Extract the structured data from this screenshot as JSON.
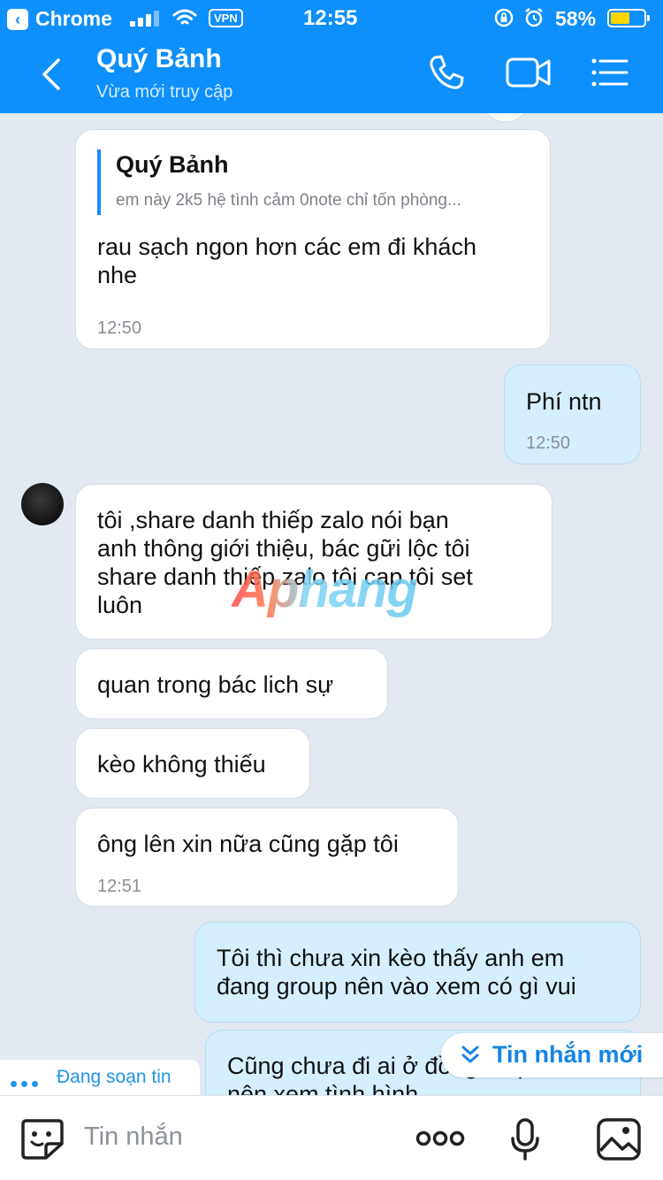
{
  "status_bar": {
    "back_app": "Chrome",
    "vpn": "VPN",
    "time": "12:55",
    "battery": "58%",
    "battery_level": 0.58
  },
  "header": {
    "name": "Quý Bảnh",
    "subtitle": "Vừa mới truy cập"
  },
  "messages": {
    "m1": {
      "quote_name": "Quý Bảnh",
      "quote_text": "em này 2k5 hệ tình cảm 0note chỉ tốn phòng...",
      "text1": "rau sạch ngon hơn các em đi khách",
      "text2": "nhe",
      "time": "12:50"
    },
    "m2": {
      "text": "Phí ntn",
      "time": "12:50"
    },
    "m3": {
      "l1": "tôi ,share danh thiếp zalo nói bạn",
      "l2": "anh thông giới thiệu,  bác gữi lộc tôi",
      "l3": "share danh thiếp zalo tôi cap tôi set",
      "l4": "luôn"
    },
    "m4": {
      "text": "quan trong bác lich sự"
    },
    "m5": {
      "text": "kèo không thiếu"
    },
    "m6": {
      "text": "ông lên xin nữa cũng gặp tôi",
      "time": "12:51"
    },
    "m7": {
      "l1": "Tôi thì chưa xin kèo thấy anh em",
      "l2": "đang group nên vào xem có gì vui"
    },
    "m8": {
      "l1": "Cũng chưa đi ai ở đồng tháp hết",
      "l2": "nên xem tình hình"
    }
  },
  "watermark": "Aphang",
  "typing_label": "Đang soạn tin",
  "new_message_label": "Tin nhắn mới",
  "composer": {
    "placeholder": "Tin nhắn"
  },
  "colors": {
    "header": "#0d8ffc",
    "chat_bg": "#e2e9f1",
    "outgoing": "#d5efff",
    "accent": "#1a8cff"
  },
  "icons": [
    "back-icon",
    "phone-icon",
    "video-call-icon",
    "menu-icon",
    "sticker-icon",
    "more-icon",
    "microphone-icon",
    "image-icon",
    "chevron-down-icon"
  ]
}
